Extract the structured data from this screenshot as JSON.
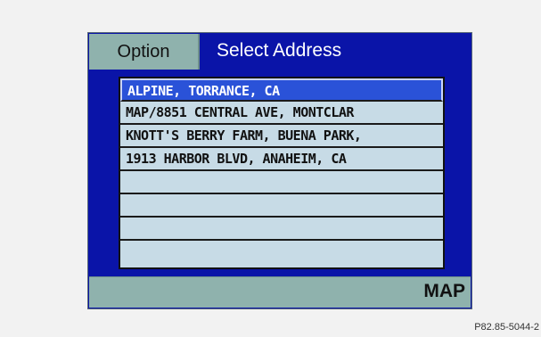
{
  "header": {
    "option_label": "Option",
    "title": "Select Address"
  },
  "address_list": {
    "items": [
      {
        "label": "ALPINE, TORRANCE, CA",
        "selected": true
      },
      {
        "label": "MAP/8851 CENTRAL AVE, MONTCLAR",
        "selected": false
      },
      {
        "label": "KNOTT'S BERRY FARM, BUENA PARK,",
        "selected": false
      },
      {
        "label": "1913 HARBOR BLVD, ANAHEIM, CA",
        "selected": false
      },
      {
        "label": "",
        "selected": false
      },
      {
        "label": "",
        "selected": false
      },
      {
        "label": "",
        "selected": false
      },
      {
        "label": "",
        "selected": false
      }
    ]
  },
  "footer": {
    "map_label": "MAP"
  },
  "reference_code": "P82.85-5044-2",
  "colors": {
    "screen_background": "#0a14a8",
    "tab_background": "#8fb2ad",
    "list_background": "#c7dbe6",
    "selected_row": "#2a52d8"
  }
}
